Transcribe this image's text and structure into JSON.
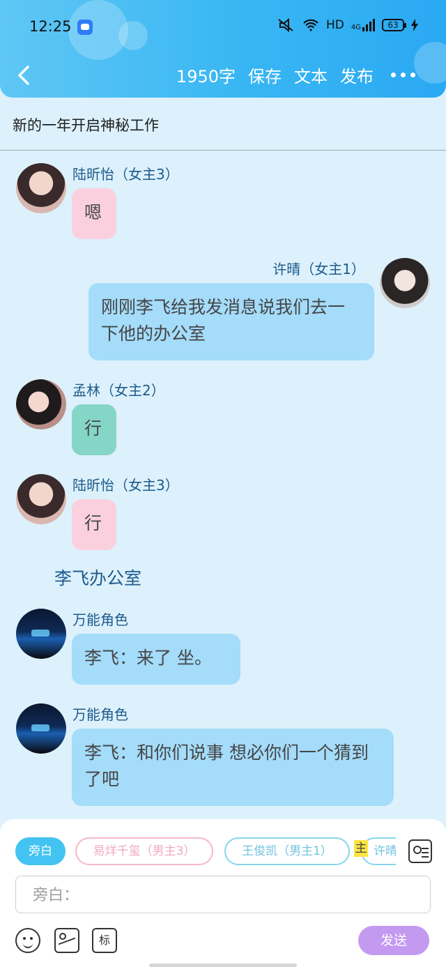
{
  "status_bar": {
    "time": "12:25",
    "network": "HD",
    "signal_type": "4G",
    "battery": "63"
  },
  "nav": {
    "word_count": "1950字",
    "save": "保存",
    "text": "文本",
    "publish": "发布"
  },
  "story_title": "新的一年开启神秘工作",
  "messages": [
    {
      "name": "陆昕怡（女主3）",
      "text": "嗯"
    },
    {
      "name": "许晴（女主1）",
      "text": "刚刚李飞给我发消息说我们去一下他的办公室"
    },
    {
      "name": "孟林（女主2）",
      "text": "行"
    },
    {
      "name": "陆昕怡（女主3）",
      "text": "行"
    },
    {
      "name": "万能角色",
      "text": "李飞：来了 坐。"
    },
    {
      "name": "万能角色",
      "text": "李飞：和你们说事 想必你们一个猜到了吧"
    }
  ],
  "scene_label": "李飞办公室",
  "roles": [
    {
      "label": "旁白"
    },
    {
      "label": "易烊千玺（男主3）"
    },
    {
      "label": "王俊凯（男主1）"
    },
    {
      "label": "许晴"
    }
  ],
  "highlight_char": "主",
  "input": {
    "placeholder": "旁白："
  },
  "toolbar": {
    "tag_label": "标",
    "send_label": "发送"
  },
  "colors": {
    "header_blue": "#38b6f3",
    "pink_bubble": "#fbd0de",
    "blue_bubble": "#a4dcfa",
    "teal_bubble": "#86d6c7",
    "send_purple": "#c39af0"
  }
}
